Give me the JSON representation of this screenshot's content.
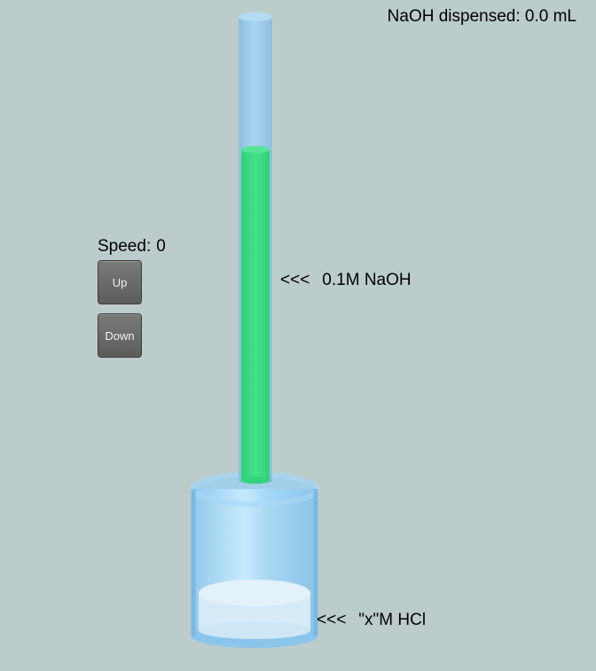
{
  "readout": {
    "label": "NaOH dispensed:",
    "value": "0.0 mL"
  },
  "speed": {
    "label": "Speed:",
    "value": "0"
  },
  "buttons": {
    "up_label": "Up",
    "down_label": "Down"
  },
  "labels": {
    "arrow": "<<<",
    "burette_solution": "0.1M NaOH",
    "beaker_solution": "\"x\"M HCl"
  },
  "colors": {
    "background": "#bccccb",
    "naoh_liquid": "#3ddc84",
    "glass": "#8fc8ec",
    "beaker_liquid": "#d6eaf8"
  },
  "burette": {
    "fill_fraction": 0.72
  }
}
